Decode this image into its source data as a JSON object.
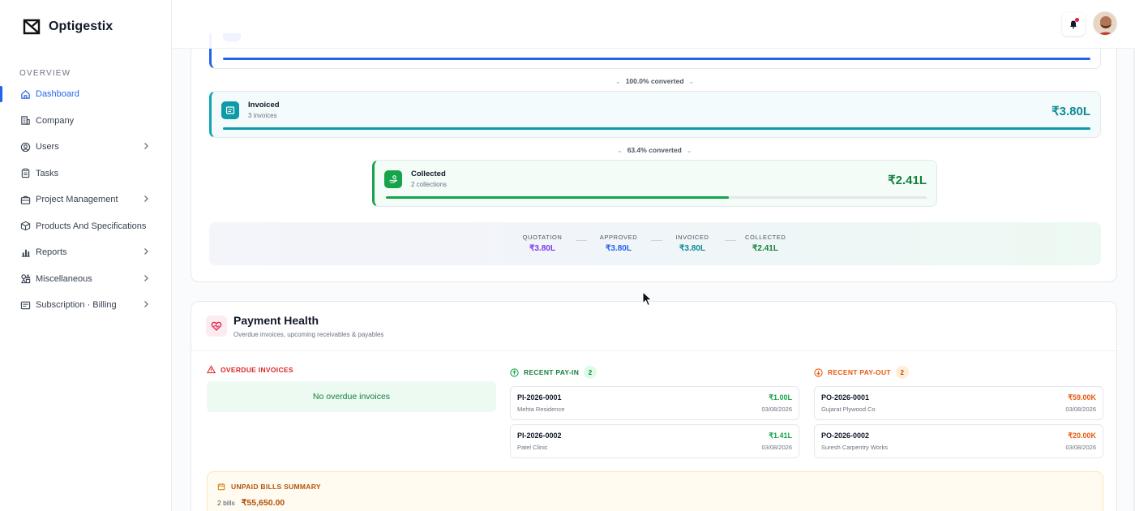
{
  "app": {
    "name": "Optigestix"
  },
  "sidebar": {
    "section_label": "OVERVIEW",
    "items": [
      {
        "label": "Dashboard",
        "icon": "home-icon"
      },
      {
        "label": "Company",
        "icon": "building-icon"
      },
      {
        "label": "Users",
        "icon": "user-circle-icon"
      },
      {
        "label": "Tasks",
        "icon": "clipboard-icon"
      },
      {
        "label": "Project Management",
        "icon": "briefcase-icon"
      },
      {
        "label": "Products And Specifications",
        "icon": "box-icon"
      },
      {
        "label": "Reports",
        "icon": "bar-chart-icon"
      },
      {
        "label": "Miscellaneous",
        "icon": "shapes-icon"
      },
      {
        "label": "Subscription · Billing",
        "icon": "receipt-icon"
      }
    ]
  },
  "funnel": {
    "conv1": "100.0% converted",
    "conv2": "63.4% converted",
    "invoiced": {
      "title": "Invoiced",
      "sub": "3 invoices",
      "value": "₹3.80L",
      "progress": 1.0
    },
    "collected": {
      "title": "Collected",
      "sub": "2 collections",
      "value": "₹2.41L",
      "progress": 0.634
    },
    "summary": [
      {
        "k": "QUOTATION",
        "v": "₹3.80L"
      },
      {
        "k": "APPROVED",
        "v": "₹3.80L"
      },
      {
        "k": "INVOICED",
        "v": "₹3.80L"
      },
      {
        "k": "COLLECTED",
        "v": "₹2.41L"
      }
    ]
  },
  "payment_health": {
    "title": "Payment Health",
    "subtitle": "Overdue invoices, upcoming receivables & payables",
    "overdue": {
      "label": "OVERDUE INVOICES",
      "empty": "No overdue invoices"
    },
    "payin": {
      "label": "RECENT PAY-IN",
      "count": "2",
      "items": [
        {
          "id": "PI-2026-0001",
          "party": "Mehta Residence",
          "amount": "₹1.00L",
          "date": "03/08/2026"
        },
        {
          "id": "PI-2026-0002",
          "party": "Patel Clinic",
          "amount": "₹1.41L",
          "date": "03/08/2026"
        }
      ]
    },
    "payout": {
      "label": "RECENT PAY-OUT",
      "count": "2",
      "items": [
        {
          "id": "PO-2026-0001",
          "party": "Gujarat Plywood Co",
          "amount": "₹59.00K",
          "date": "03/08/2026"
        },
        {
          "id": "PO-2026-0002",
          "party": "Suresh Carpentry Works",
          "amount": "₹20.00K",
          "date": "03/08/2026"
        }
      ]
    },
    "unpaid": {
      "label": "UNPAID BILLS SUMMARY",
      "bills": "2 bills",
      "amount": "₹55,650.00"
    }
  },
  "colors": {
    "accent": "#2563eb",
    "invoiced": "#0e9aa7",
    "collected": "#15a34a",
    "payin": "#16a34a",
    "payout": "#ea580c",
    "danger": "#dc2626"
  }
}
